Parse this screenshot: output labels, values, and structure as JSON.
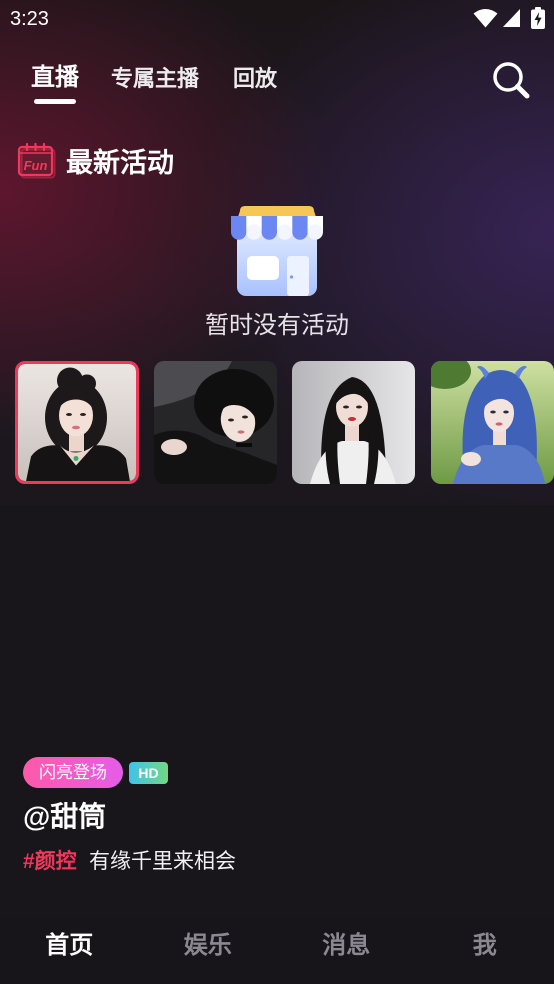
{
  "status_bar": {
    "time": "3:23",
    "icons": [
      "wifi-icon",
      "signal-icon",
      "battery-charging-icon"
    ]
  },
  "top_tabs": {
    "items": [
      {
        "label": "直播",
        "active": true
      },
      {
        "label": "专属主播",
        "active": false
      },
      {
        "label": "回放",
        "active": false
      }
    ],
    "search_icon": "search-icon"
  },
  "activities": {
    "icon": "fun-calendar-icon",
    "icon_text": "Fun",
    "title": "最新活动",
    "empty_icon": "store-icon",
    "empty_text": "暂时没有活动"
  },
  "streamers": [
    {
      "selected": true
    },
    {
      "selected": false
    },
    {
      "selected": false
    },
    {
      "selected": false
    }
  ],
  "live_info": {
    "badge": "闪亮登场",
    "quality": "HD",
    "name": "@甜筒",
    "tag": "#颜控",
    "slogan": "有缘千里来相会"
  },
  "bottom_nav": {
    "items": [
      {
        "label": "首页",
        "active": true
      },
      {
        "label": "娱乐",
        "active": false
      },
      {
        "label": "消息",
        "active": false
      },
      {
        "label": "我",
        "active": false
      }
    ]
  },
  "colors": {
    "accent": "#f0375c",
    "background": "#18141b",
    "badge_gradient": [
      "#ff5aa8",
      "#e45ce8"
    ],
    "hd_gradient": [
      "#3fc3ea",
      "#72d884"
    ],
    "inactive_text": "#8c8892"
  }
}
